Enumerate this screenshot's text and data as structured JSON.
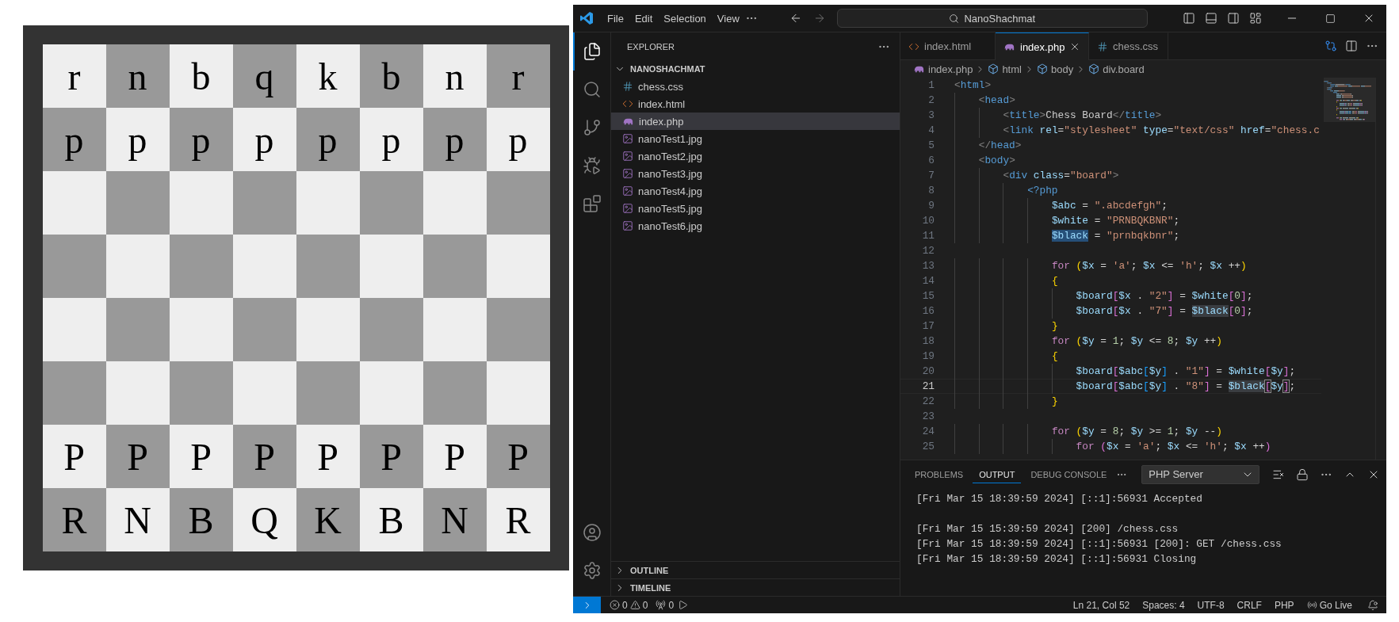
{
  "board": {
    "rows": [
      [
        "r",
        "n",
        "b",
        "q",
        "k",
        "b",
        "n",
        "r"
      ],
      [
        "p",
        "p",
        "p",
        "p",
        "p",
        "p",
        "p",
        "p"
      ],
      [
        null,
        null,
        null,
        null,
        null,
        null,
        null,
        null
      ],
      [
        null,
        null,
        null,
        null,
        null,
        null,
        null,
        null
      ],
      [
        null,
        null,
        null,
        null,
        null,
        null,
        null,
        null
      ],
      [
        null,
        null,
        null,
        null,
        null,
        null,
        null,
        null
      ],
      [
        "P",
        "P",
        "P",
        "P",
        "P",
        "P",
        "P",
        "P"
      ],
      [
        "R",
        "N",
        "B",
        "Q",
        "K",
        "B",
        "N",
        "R"
      ]
    ]
  },
  "editor_window": {
    "menu": [
      "File",
      "Edit",
      "Selection",
      "View"
    ],
    "command_center": "NanoShachmat",
    "activity_bar": [
      {
        "selected": true
      },
      {
        "selected": false
      },
      {
        "selected": false
      },
      {
        "selected": false
      },
      {
        "selected": false
      }
    ],
    "sidebar": {
      "title": "EXPLORER",
      "folder": {
        "name": "NANOSHACHMAT",
        "expanded": true,
        "files": [
          {
            "name": "chess.css",
            "kind": "css",
            "selected": false
          },
          {
            "name": "index.html",
            "kind": "html",
            "selected": false
          },
          {
            "name": "index.php",
            "kind": "php",
            "selected": true
          },
          {
            "name": "nanoTest1.jpg",
            "kind": "image",
            "selected": false
          },
          {
            "name": "nanoTest2.jpg",
            "kind": "image",
            "selected": false
          },
          {
            "name": "nanoTest3.jpg",
            "kind": "image",
            "selected": false
          },
          {
            "name": "nanoTest4.jpg",
            "kind": "image",
            "selected": false
          },
          {
            "name": "nanoTest5.jpg",
            "kind": "image",
            "selected": false
          },
          {
            "name": "nanoTest6.jpg",
            "kind": "image",
            "selected": false
          }
        ]
      },
      "sections": [
        {
          "name": "OUTLINE",
          "expanded": false
        },
        {
          "name": "TIMELINE",
          "expanded": false
        }
      ]
    },
    "tabs": [
      {
        "label": "index.html",
        "kind": "html",
        "selected": false
      },
      {
        "label": "index.php",
        "kind": "php",
        "selected": true
      },
      {
        "label": "chess.css",
        "kind": "css",
        "selected": false
      }
    ],
    "breadcrumbs": [
      {
        "label": "index.php",
        "kind": "php"
      },
      {
        "label": "html",
        "kind": "element"
      },
      {
        "label": "body",
        "kind": "element"
      },
      {
        "label": "div.board",
        "kind": "element"
      }
    ],
    "code": [
      {
        "number": "1",
        "current": false,
        "tokens": [
          {
            "kind": "punct",
            "text": "<"
          },
          {
            "kind": "tag",
            "text": "html"
          },
          {
            "kind": "punct",
            "text": ">"
          }
        ]
      },
      {
        "number": "2",
        "current": false,
        "tokens": [
          {
            "kind": "punct",
            "text": "    <"
          },
          {
            "kind": "tag",
            "text": "head"
          },
          {
            "kind": "punct",
            "text": ">"
          }
        ]
      },
      {
        "number": "3",
        "current": false,
        "tokens": [
          {
            "kind": "punct",
            "text": "        <"
          },
          {
            "kind": "tag",
            "text": "title"
          },
          {
            "kind": "punct",
            "text": ">"
          },
          {
            "kind": "text",
            "text": "Chess Board"
          },
          {
            "kind": "punct",
            "text": "</"
          },
          {
            "kind": "tag",
            "text": "title"
          },
          {
            "kind": "punct",
            "text": ">"
          }
        ]
      },
      {
        "number": "4",
        "current": false,
        "tokens": [
          {
            "kind": "punct",
            "text": "        <"
          },
          {
            "kind": "tag",
            "text": "link"
          },
          {
            "kind": "attr",
            "text": " rel"
          },
          {
            "kind": "op",
            "text": "="
          },
          {
            "kind": "str",
            "text": "\"stylesheet\""
          },
          {
            "kind": "attr",
            "text": " type"
          },
          {
            "kind": "op",
            "text": "="
          },
          {
            "kind": "str",
            "text": "\"text/css\""
          },
          {
            "kind": "attr",
            "text": " href"
          },
          {
            "kind": "op",
            "text": "="
          },
          {
            "kind": "str",
            "text": "\"chess.c"
          }
        ]
      },
      {
        "number": "5",
        "current": false,
        "tokens": [
          {
            "kind": "punct",
            "text": "    </"
          },
          {
            "kind": "tag",
            "text": "head"
          },
          {
            "kind": "punct",
            "text": ">"
          }
        ]
      },
      {
        "number": "6",
        "current": false,
        "tokens": [
          {
            "kind": "punct",
            "text": "    <"
          },
          {
            "kind": "tag",
            "text": "body"
          },
          {
            "kind": "punct",
            "text": ">"
          }
        ]
      },
      {
        "number": "7",
        "current": false,
        "tokens": [
          {
            "kind": "punct",
            "text": "        <"
          },
          {
            "kind": "tag",
            "text": "div"
          },
          {
            "kind": "attr",
            "text": " class"
          },
          {
            "kind": "op",
            "text": "="
          },
          {
            "kind": "str",
            "text": "\"board\""
          },
          {
            "kind": "punct",
            "text": ">"
          }
        ]
      },
      {
        "number": "8",
        "current": false,
        "tokens": [
          {
            "kind": "tag",
            "text": "            <?php"
          }
        ]
      },
      {
        "number": "9",
        "current": false,
        "tokens": [
          {
            "kind": "var",
            "text": "                $abc"
          },
          {
            "kind": "op",
            "text": " = "
          },
          {
            "kind": "str",
            "text": "\".abcdefgh\""
          },
          {
            "kind": "op",
            "text": ";"
          }
        ]
      },
      {
        "number": "10",
        "current": false,
        "tokens": [
          {
            "kind": "var",
            "text": "                $white"
          },
          {
            "kind": "op",
            "text": " = "
          },
          {
            "kind": "str",
            "text": "\"PRNBQKBNR\""
          },
          {
            "kind": "op",
            "text": ";"
          }
        ]
      },
      {
        "number": "11",
        "current": false,
        "tokens": [
          {
            "kind": "sel",
            "text": "                $black"
          },
          {
            "kind": "op",
            "text": " = "
          },
          {
            "kind": "str",
            "text": "\"prnbqkbnr\""
          },
          {
            "kind": "op",
            "text": ";"
          }
        ]
      },
      {
        "number": "12",
        "current": false
      },
      {
        "number": "13",
        "current": false,
        "tokens": [
          {
            "kind": "kw",
            "text": "                for"
          },
          {
            "kind": "b1",
            "text": " ("
          },
          {
            "kind": "var",
            "text": "$x"
          },
          {
            "kind": "op",
            "text": " = "
          },
          {
            "kind": "str",
            "text": "'a'"
          },
          {
            "kind": "op",
            "text": "; "
          },
          {
            "kind": "var",
            "text": "$x"
          },
          {
            "kind": "op",
            "text": " <= "
          },
          {
            "kind": "str",
            "text": "'h'"
          },
          {
            "kind": "op",
            "text": "; "
          },
          {
            "kind": "var",
            "text": "$x"
          },
          {
            "kind": "op",
            "text": " ++"
          },
          {
            "kind": "b1",
            "text": ")"
          }
        ]
      },
      {
        "number": "14",
        "current": false,
        "tokens": [
          {
            "kind": "b1",
            "text": "                {"
          }
        ]
      },
      {
        "number": "15",
        "current": false,
        "tokens": [
          {
            "kind": "var",
            "text": "                    $board"
          },
          {
            "kind": "b2",
            "text": "["
          },
          {
            "kind": "var",
            "text": "$x"
          },
          {
            "kind": "op",
            "text": " . "
          },
          {
            "kind": "str",
            "text": "\"2\""
          },
          {
            "kind": "b2",
            "text": "]"
          },
          {
            "kind": "op",
            "text": " = "
          },
          {
            "kind": "var",
            "text": "$white"
          },
          {
            "kind": "b2",
            "text": "["
          },
          {
            "kind": "num",
            "text": "0"
          },
          {
            "kind": "b2",
            "text": "]"
          },
          {
            "kind": "op",
            "text": ";"
          }
        ]
      },
      {
        "number": "16",
        "current": false,
        "tokens": [
          {
            "kind": "var",
            "text": "                    $board"
          },
          {
            "kind": "b2",
            "text": "["
          },
          {
            "kind": "var",
            "text": "$x"
          },
          {
            "kind": "op",
            "text": " . "
          },
          {
            "kind": "str",
            "text": "\"7\""
          },
          {
            "kind": "b2",
            "text": "]"
          },
          {
            "kind": "op",
            "text": " = "
          },
          {
            "kind": "occ",
            "text": "$black"
          },
          {
            "kind": "b2",
            "text": "["
          },
          {
            "kind": "num",
            "text": "0"
          },
          {
            "kind": "b2",
            "text": "]"
          },
          {
            "kind": "op",
            "text": ";"
          }
        ]
      },
      {
        "number": "17",
        "current": false,
        "tokens": [
          {
            "kind": "b1",
            "text": "                }"
          }
        ]
      },
      {
        "number": "18",
        "current": false,
        "tokens": [
          {
            "kind": "kw",
            "text": "                for"
          },
          {
            "kind": "b1",
            "text": " ("
          },
          {
            "kind": "var",
            "text": "$y"
          },
          {
            "kind": "op",
            "text": " = "
          },
          {
            "kind": "num",
            "text": "1"
          },
          {
            "kind": "op",
            "text": "; "
          },
          {
            "kind": "var",
            "text": "$y"
          },
          {
            "kind": "op",
            "text": " <= "
          },
          {
            "kind": "num",
            "text": "8"
          },
          {
            "kind": "op",
            "text": "; "
          },
          {
            "kind": "var",
            "text": "$y"
          },
          {
            "kind": "op",
            "text": " ++"
          },
          {
            "kind": "b1",
            "text": ")"
          }
        ]
      },
      {
        "number": "19",
        "current": false,
        "tokens": [
          {
            "kind": "b1",
            "text": "                {"
          }
        ]
      },
      {
        "number": "20",
        "current": false,
        "tokens": [
          {
            "kind": "var",
            "text": "                    $board"
          },
          {
            "kind": "b2",
            "text": "["
          },
          {
            "kind": "var",
            "text": "$abc"
          },
          {
            "kind": "b3",
            "text": "["
          },
          {
            "kind": "var",
            "text": "$y"
          },
          {
            "kind": "b3",
            "text": "]"
          },
          {
            "kind": "op",
            "text": " . "
          },
          {
            "kind": "str",
            "text": "\"1\""
          },
          {
            "kind": "b2",
            "text": "]"
          },
          {
            "kind": "op",
            "text": " = "
          },
          {
            "kind": "var",
            "text": "$white"
          },
          {
            "kind": "b2",
            "text": "["
          },
          {
            "kind": "var",
            "text": "$y"
          },
          {
            "kind": "b2",
            "text": "]"
          },
          {
            "kind": "op",
            "text": ";"
          }
        ]
      },
      {
        "number": "21",
        "current": true,
        "tokens": [
          {
            "kind": "var",
            "text": "                    $board"
          },
          {
            "kind": "b2",
            "text": "["
          },
          {
            "kind": "var",
            "text": "$abc"
          },
          {
            "kind": "b3",
            "text": "["
          },
          {
            "kind": "var",
            "text": "$y"
          },
          {
            "kind": "b3",
            "text": "]"
          },
          {
            "kind": "op",
            "text": " . "
          },
          {
            "kind": "str",
            "text": "\"8\""
          },
          {
            "kind": "b2",
            "text": "]"
          },
          {
            "kind": "op",
            "text": " = "
          },
          {
            "kind": "occ",
            "text": "$black"
          },
          {
            "kind": "match",
            "text": "["
          },
          {
            "kind": "var",
            "text": "$y"
          },
          {
            "kind": "match",
            "text": "]"
          },
          {
            "kind": "op",
            "text": ";"
          }
        ]
      },
      {
        "number": "22",
        "current": false,
        "tokens": [
          {
            "kind": "b1",
            "text": "                }"
          }
        ]
      },
      {
        "number": "23",
        "current": false
      },
      {
        "number": "24",
        "current": false,
        "tokens": [
          {
            "kind": "kw",
            "text": "                for"
          },
          {
            "kind": "b1",
            "text": " ("
          },
          {
            "kind": "var",
            "text": "$y"
          },
          {
            "kind": "op",
            "text": " = "
          },
          {
            "kind": "num",
            "text": "8"
          },
          {
            "kind": "op",
            "text": "; "
          },
          {
            "kind": "var",
            "text": "$y"
          },
          {
            "kind": "op",
            "text": " >= "
          },
          {
            "kind": "num",
            "text": "1"
          },
          {
            "kind": "op",
            "text": "; "
          },
          {
            "kind": "var",
            "text": "$y"
          },
          {
            "kind": "op",
            "text": " --"
          },
          {
            "kind": "b1",
            "text": ")"
          }
        ]
      },
      {
        "number": "25",
        "current": false,
        "tokens": [
          {
            "kind": "kw",
            "text": "                    for"
          },
          {
            "kind": "b2",
            "text": " ("
          },
          {
            "kind": "var",
            "text": "$x"
          },
          {
            "kind": "op",
            "text": " = "
          },
          {
            "kind": "str",
            "text": "'a'"
          },
          {
            "kind": "op",
            "text": "; "
          },
          {
            "kind": "var",
            "text": "$x"
          },
          {
            "kind": "op",
            "text": " <= "
          },
          {
            "kind": "str",
            "text": "'h'"
          },
          {
            "kind": "op",
            "text": "; "
          },
          {
            "kind": "var",
            "text": "$x"
          },
          {
            "kind": "op",
            "text": " ++"
          },
          {
            "kind": "b2",
            "text": ")"
          }
        ]
      }
    ],
    "panel": {
      "tabs": [
        {
          "label": "PROBLEMS",
          "selected": false
        },
        {
          "label": "OUTPUT",
          "selected": true
        },
        {
          "label": "DEBUG CONSOLE",
          "selected": false
        }
      ],
      "channel": "PHP Server",
      "output": [
        {
          "kind": "line",
          "text": "[Fri Mar 15 18:39:59 2024] [::1]:56931 Accepted"
        },
        {
          "kind": "blank"
        },
        {
          "kind": "line",
          "text": "[Fri Mar 15 15:39:59 2024] [200] /chess.css"
        },
        {
          "kind": "line",
          "text": "[Fri Mar 15 18:39:59 2024] [::1]:56931 [200]: GET /chess.css"
        },
        {
          "kind": "line",
          "text": "[Fri Mar 15 18:39:59 2024] [::1]:56931 Closing"
        }
      ]
    },
    "status_bar": {
      "errors": "0",
      "warnings": "0",
      "ports": "0",
      "items": [
        "Ln 21, Col 52",
        "Spaces: 4",
        "UTF-8",
        "CRLF",
        "PHP"
      ],
      "go_live": "Go Live"
    }
  }
}
